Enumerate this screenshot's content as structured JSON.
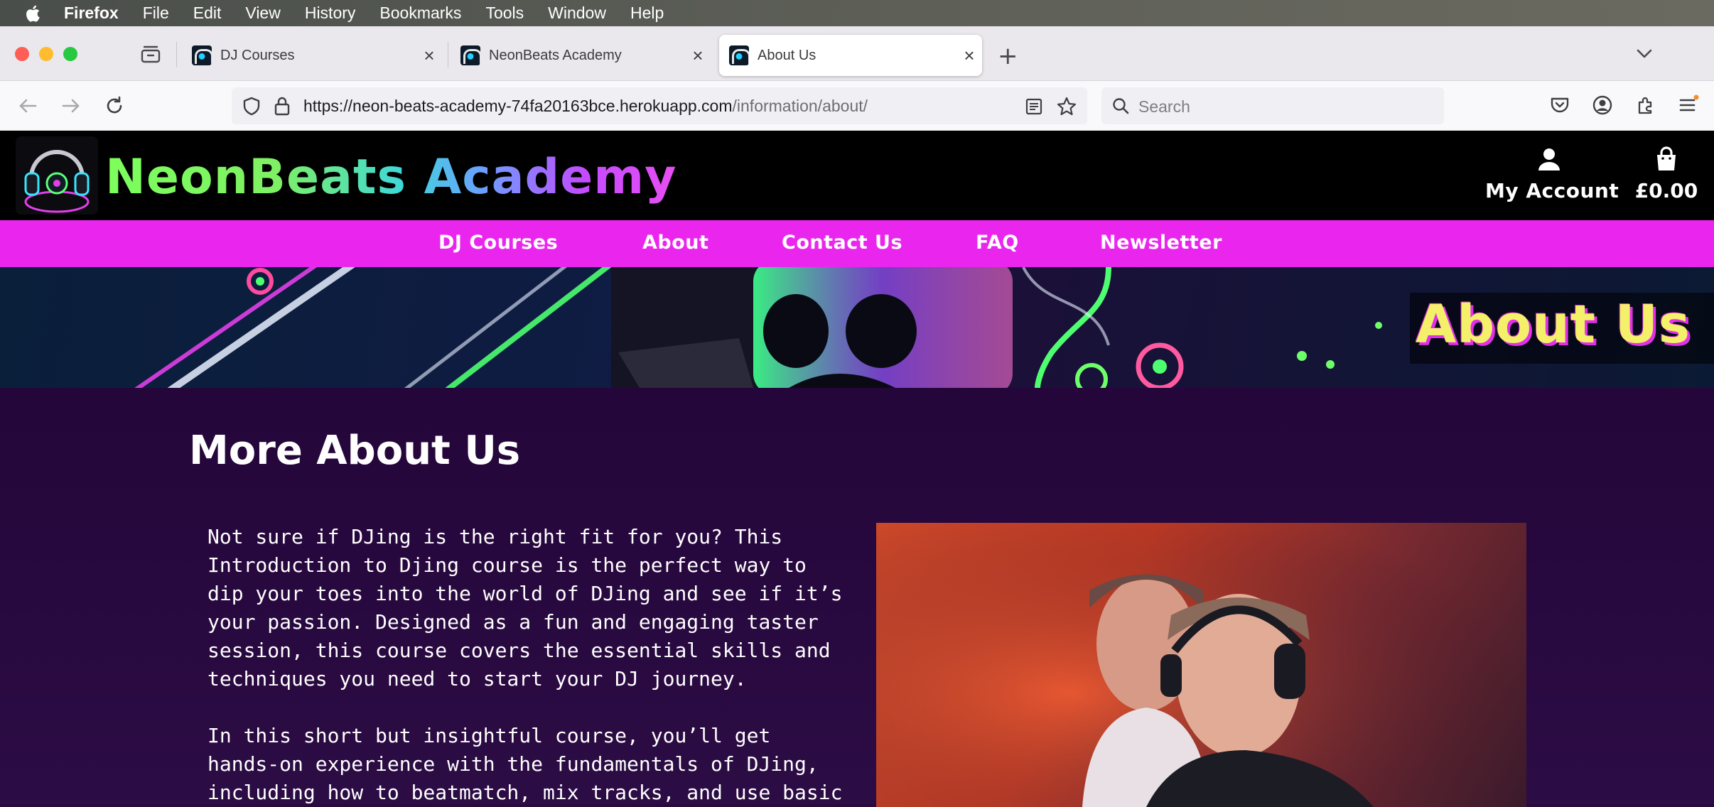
{
  "os_menubar": {
    "app_name": "Firefox",
    "items": [
      "File",
      "Edit",
      "View",
      "History",
      "Bookmarks",
      "Tools",
      "Window",
      "Help"
    ]
  },
  "browser": {
    "tabs": [
      {
        "title": "DJ Courses",
        "active": false
      },
      {
        "title": "NeonBeats Academy",
        "active": false
      },
      {
        "title": "About Us",
        "active": true
      }
    ],
    "url_host": "https://neon-beats-academy-74fa20163bce.herokuapp.com",
    "url_path": "/information/about/",
    "search_placeholder": "Search"
  },
  "site": {
    "brand": "NeonBeats Academy",
    "account_label": "My Account",
    "basket_total": "£0.00",
    "nav": [
      "DJ Courses",
      "About",
      "Contact Us",
      "FAQ",
      "Newsletter"
    ],
    "banner_title": "About Us"
  },
  "main": {
    "title": "More About Us",
    "paragraphs": [
      "Not sure if DJing is the right fit for you? This\nIntroduction to Djing course is the perfect way to\ndip your toes into the world of DJing and see if it’s\nyour passion. Designed as a fun and engaging taster\nsession, this course covers the essential skills and\ntechniques you need to start your DJ journey.",
      "In this short but insightful course, you’ll get\nhands-on experience with the fundamentals of DJing,\nincluding how to beatmatch, mix tracks, and use basic"
    ]
  },
  "colors": {
    "nav_bg": "#ea26ee",
    "content_bg": "#24063a",
    "banner_title": "#f4f06a"
  }
}
